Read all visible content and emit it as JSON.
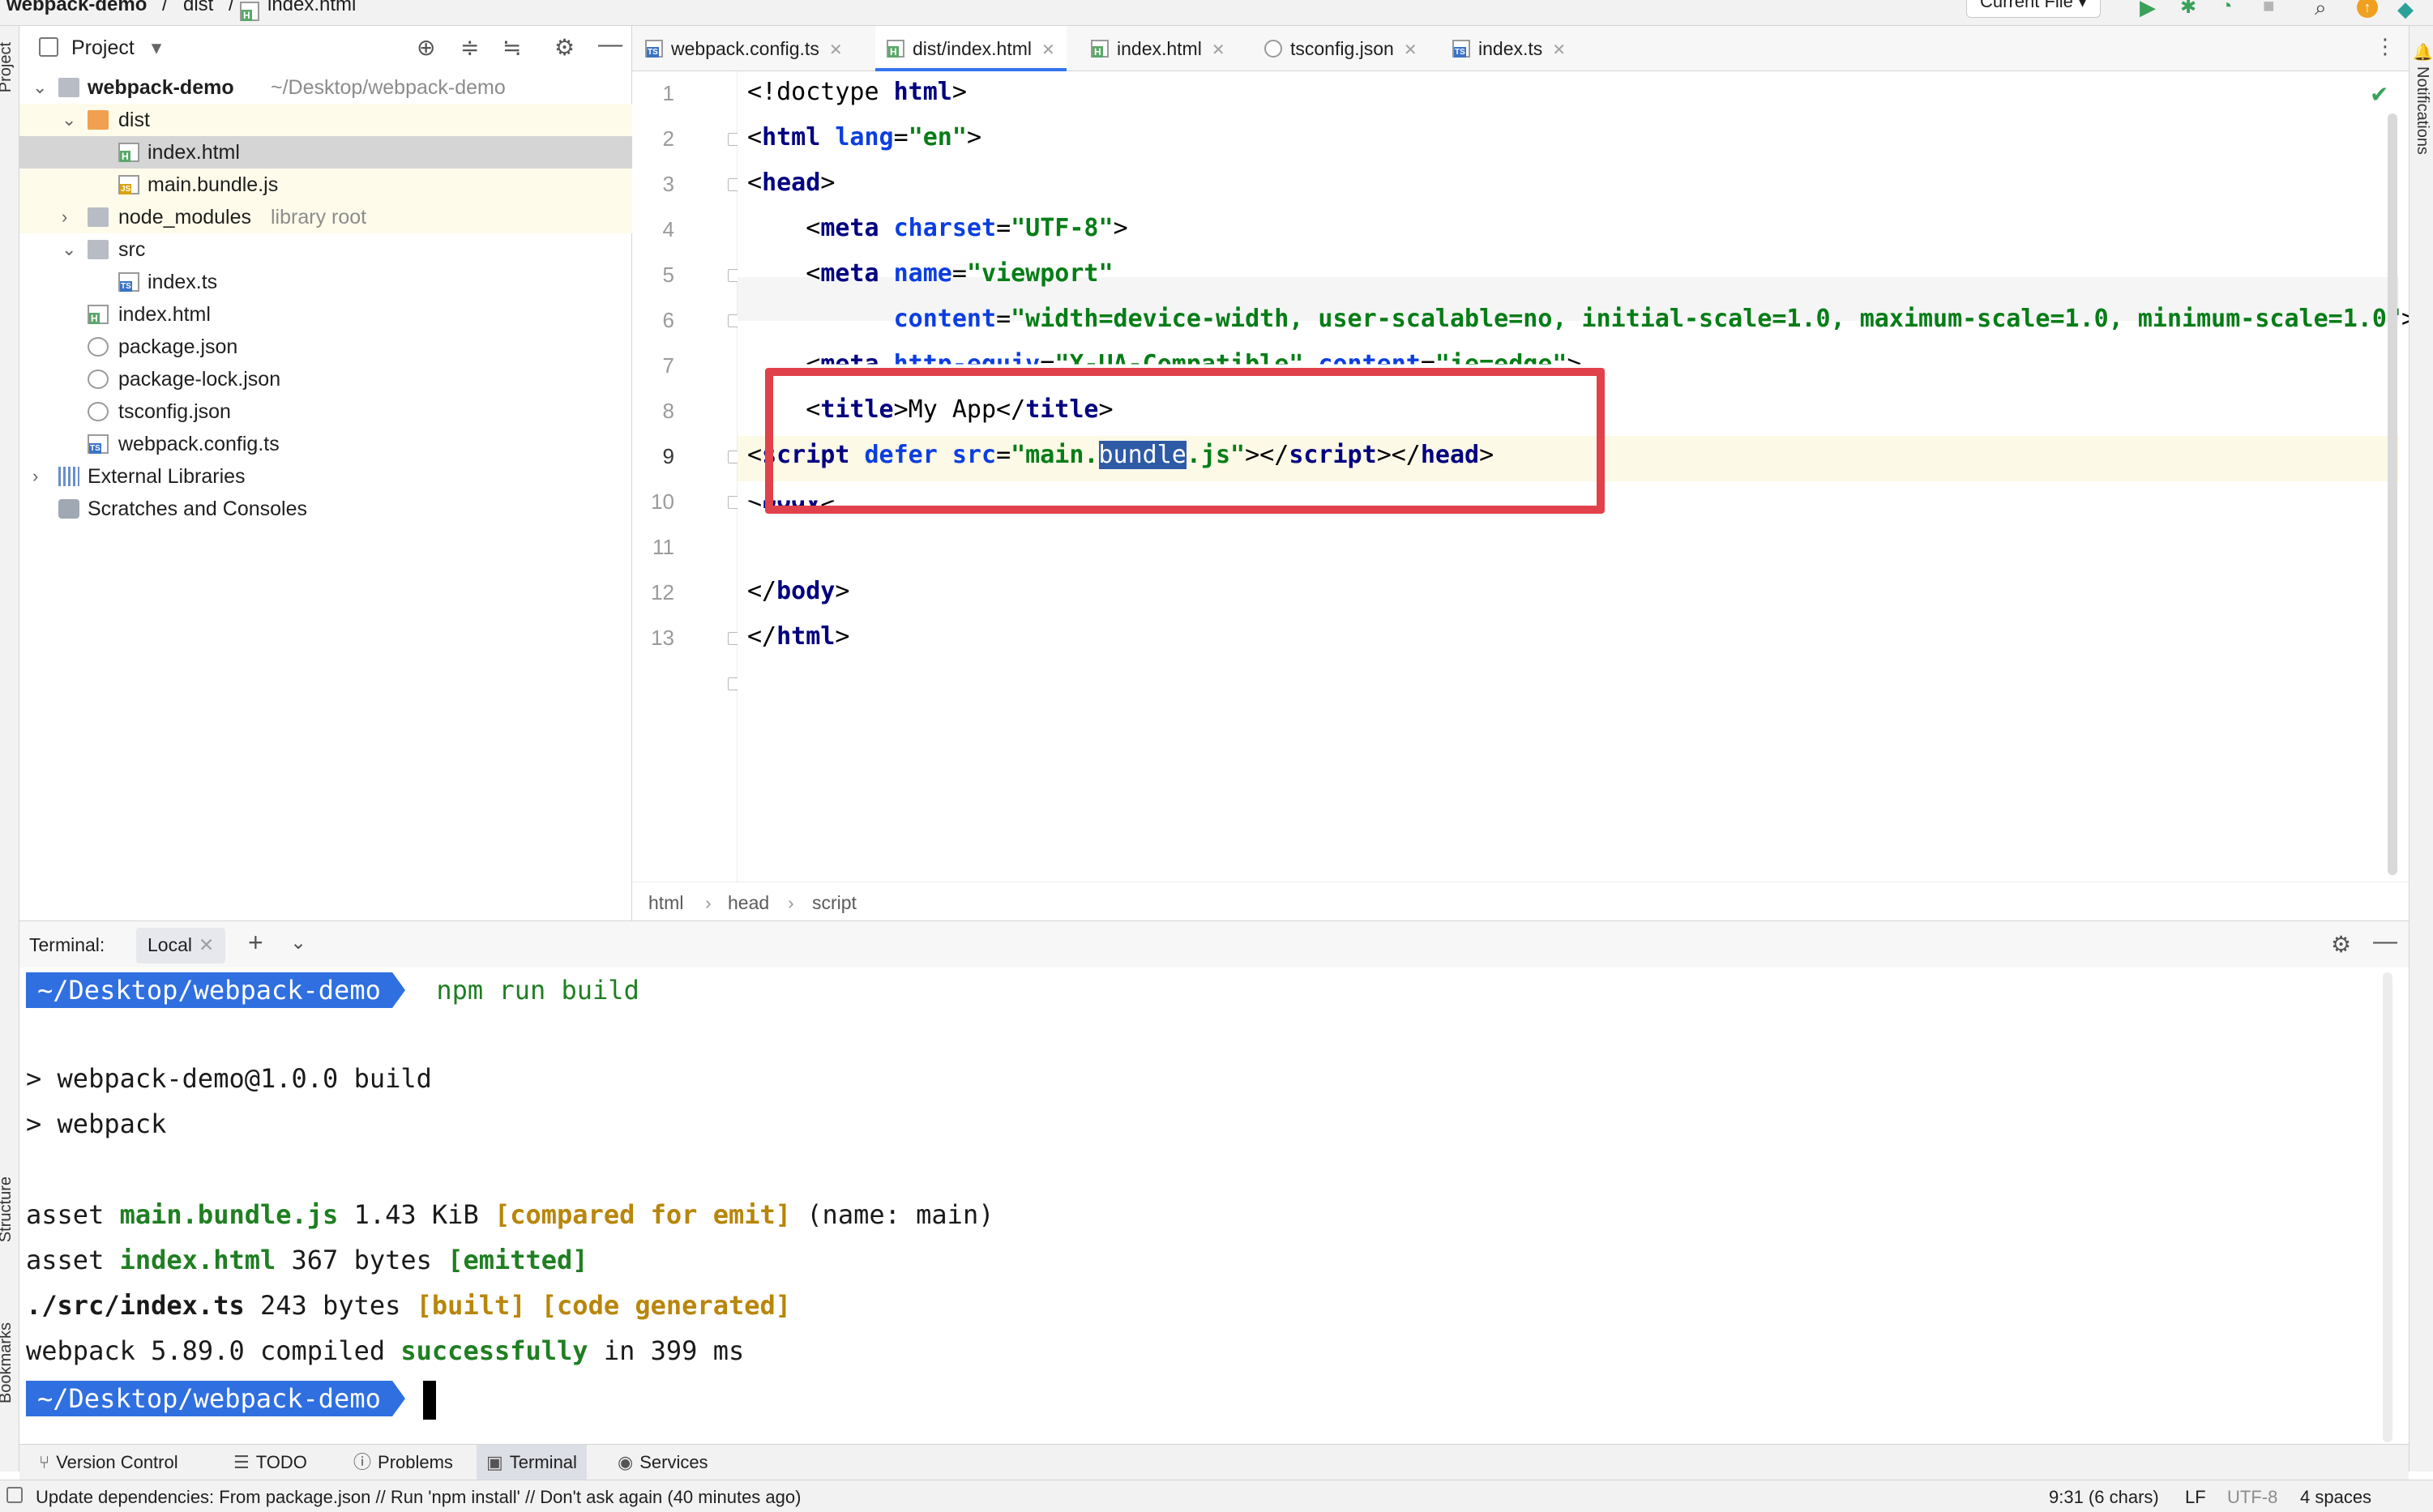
{
  "nav": {
    "project": "webpack-demo",
    "folder": "dist",
    "file": "index.html",
    "run_config": "Current File"
  },
  "left_strip": {
    "project": "Project",
    "structure": "Structure",
    "bookmarks": "Bookmarks"
  },
  "right_strip": {
    "notifications": "Notifications"
  },
  "project_panel": {
    "title": "Project",
    "tree": [
      {
        "label": "webpack-demo",
        "hint": "~/Desktop/webpack-demo",
        "icon": "folder-icon"
      },
      {
        "label": "dist",
        "hint": "",
        "icon": "folder-icon"
      },
      {
        "label": "index.html",
        "hint": "",
        "icon": "html-file-icon"
      },
      {
        "label": "main.bundle.js",
        "hint": "",
        "icon": "js-file-icon"
      },
      {
        "label": "node_modules",
        "hint": "library root",
        "icon": "folder-icon"
      },
      {
        "label": "src",
        "hint": "",
        "icon": "folder-icon"
      },
      {
        "label": "index.ts",
        "hint": "",
        "icon": "ts-file-icon"
      },
      {
        "label": "index.html",
        "hint": "",
        "icon": "html-file-icon"
      },
      {
        "label": "package.json",
        "hint": "",
        "icon": "json-file-icon"
      },
      {
        "label": "package-lock.json",
        "hint": "",
        "icon": "json-file-icon"
      },
      {
        "label": "tsconfig.json",
        "hint": "",
        "icon": "json-file-icon"
      },
      {
        "label": "webpack.config.ts",
        "hint": "",
        "icon": "ts-file-icon"
      },
      {
        "label": "External Libraries",
        "hint": "",
        "icon": "library-icon"
      },
      {
        "label": "Scratches and Consoles",
        "hint": "",
        "icon": "scratch-icon"
      }
    ]
  },
  "tabs": [
    {
      "label": "webpack.config.ts",
      "icon": "ts-file-icon"
    },
    {
      "label": "dist/index.html",
      "icon": "html-file-icon"
    },
    {
      "label": "index.html",
      "icon": "html-file-icon"
    },
    {
      "label": "tsconfig.json",
      "icon": "json-file-icon"
    },
    {
      "label": "index.ts",
      "icon": "ts-file-icon"
    }
  ],
  "editor": {
    "line_numbers": [
      "1",
      "2",
      "3",
      "4",
      "5",
      "6",
      "7",
      "8",
      "9",
      "10",
      "11",
      "12",
      "13"
    ],
    "current_line": "9",
    "lines": {
      "l1": [
        "<!doctype ",
        "html",
        ">"
      ],
      "l2": [
        "<",
        "html",
        " ",
        "lang",
        "=",
        "\"en\"",
        ">"
      ],
      "l3": [
        "<",
        "head",
        ">"
      ],
      "l4": [
        "    <",
        "meta",
        " ",
        "charset",
        "=",
        "\"UTF-8\"",
        ">"
      ],
      "l5": [
        "    <",
        "meta",
        " ",
        "name",
        "=",
        "\"viewport\""
      ],
      "l6": [
        "          ",
        "content",
        "=",
        "\"width=device-width, user-scalable=no, initial-scale=1.0, maximum-scale=1.0, minimum-scale=1.0\"",
        ">"
      ],
      "l7": [
        "    <",
        "meta",
        " ",
        "http-equiv",
        "=",
        "\"X-UA-Compatible\"",
        " ",
        "content",
        "=",
        "\"ie=edge\"",
        ">"
      ],
      "l8": [
        "    <",
        "title",
        ">My App</",
        "title",
        ">"
      ],
      "l9": [
        "<",
        "script",
        " ",
        "defer",
        " ",
        "src",
        "=",
        "\"main.",
        "bundle",
        ".js\"",
        "></",
        "script",
        "></",
        "head",
        ">"
      ],
      "l10": [
        "<",
        "body",
        ">"
      ],
      "l11": [
        ""
      ],
      "l12": [
        "</",
        "body",
        ">"
      ],
      "l13": [
        "</",
        "html",
        ">"
      ]
    }
  },
  "editor_breadcrumb": [
    "html",
    "head",
    "script"
  ],
  "terminal": {
    "label": "Terminal:",
    "tab": "Local",
    "prompt": "~/Desktop/webpack-demo",
    "command": "npm run build",
    "out_build": "> webpack-demo@1.0.0 build",
    "out_webpack": "> webpack",
    "asset1": [
      "asset ",
      "main.bundle.js",
      " 1.43 KiB ",
      "[compared for emit]",
      " (name: main)"
    ],
    "asset2": [
      "asset ",
      "index.html",
      " 367 bytes ",
      "[emitted]"
    ],
    "module": [
      "./src/index.ts",
      " 243 bytes ",
      "[built]",
      " ",
      "[code generated]"
    ],
    "compiled": [
      "webpack 5.89.0 compiled ",
      "successfully",
      " in 399 ms"
    ]
  },
  "tool_windows": [
    {
      "label": "Version Control",
      "icon": "version-control-icon"
    },
    {
      "label": "TODO",
      "icon": "todo-icon"
    },
    {
      "label": "Problems",
      "icon": "problems-icon"
    },
    {
      "label": "Terminal",
      "icon": "terminal-icon"
    },
    {
      "label": "Services",
      "icon": "services-icon"
    }
  ],
  "status": {
    "message": "Update dependencies: From package.json // Run 'npm install' // Don't ask again (40 minutes ago)",
    "position": "9:31 (6 chars)",
    "line_sep": "LF",
    "encoding": "UTF-8",
    "indent": "4 spaces"
  },
  "colors": {
    "accent": "#3574f0",
    "highlight_box": "#e1414a",
    "tag": "#000080",
    "attr": "#0b3ee1",
    "string": "#067d17",
    "terminal_prompt": "#2f6fe0"
  }
}
